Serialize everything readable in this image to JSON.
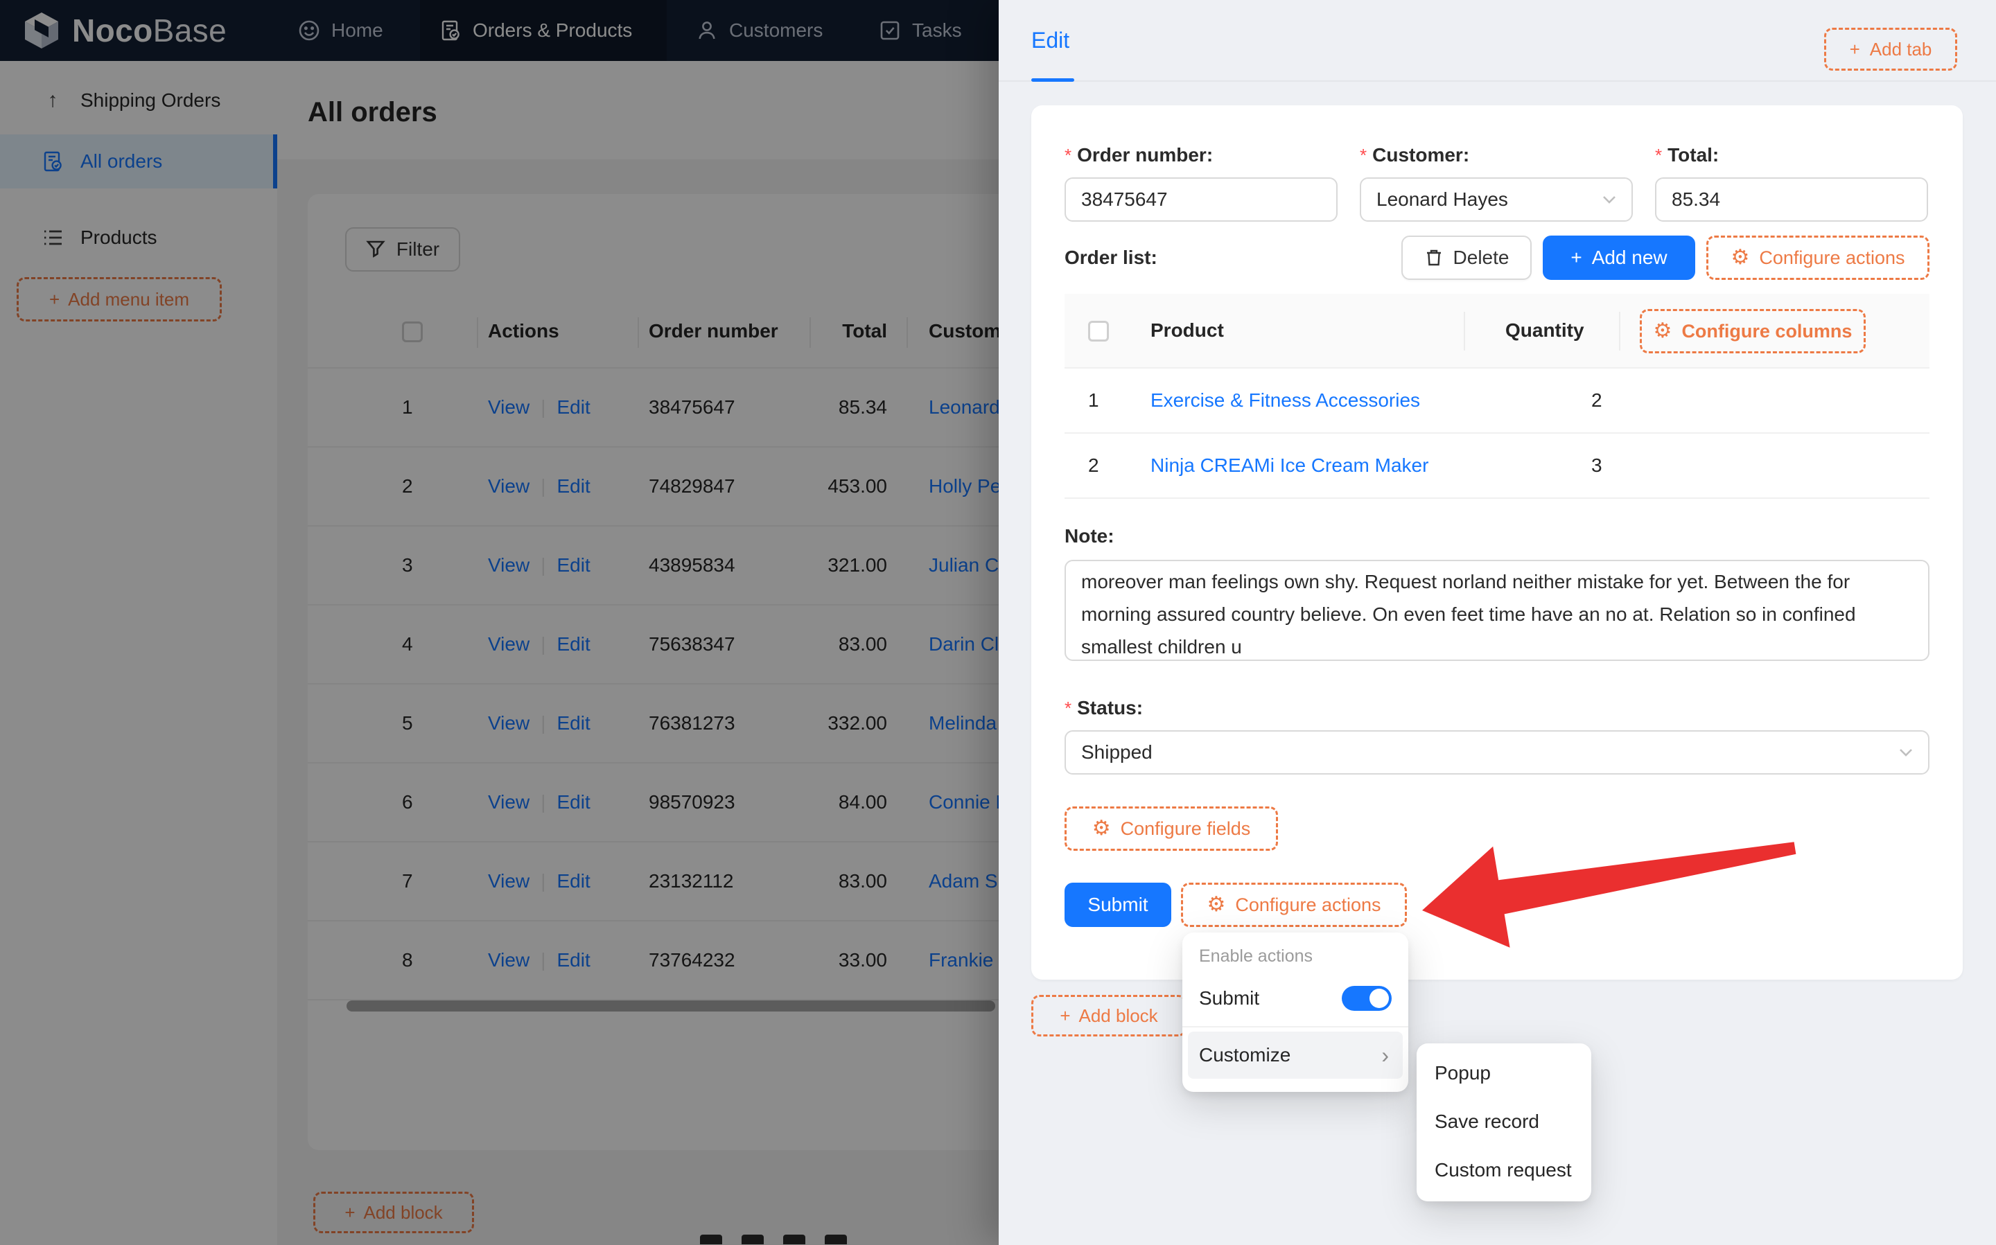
{
  "navbar": {
    "logo": {
      "brand_primary": "Noco",
      "brand_secondary": "Base"
    },
    "items": [
      {
        "label": "Home"
      },
      {
        "label": "Orders & Products"
      },
      {
        "label": "Customers"
      },
      {
        "label": "Tasks"
      }
    ]
  },
  "sidebar": {
    "items": [
      {
        "label": "Shipping Orders"
      },
      {
        "label": "All orders"
      },
      {
        "label": "Products"
      }
    ],
    "add_menu_item_label": "Add menu item"
  },
  "main": {
    "title": "All orders",
    "filter_label": "Filter",
    "add_block_label": "Add block",
    "table": {
      "headers": {
        "actions": "Actions",
        "order_number": "Order number",
        "total": "Total",
        "customer": "Customer"
      },
      "view_label": "View",
      "edit_label": "Edit",
      "rows": [
        {
          "index": "1",
          "order_number": "38475647",
          "total": "85.34",
          "customer": "Leonard Hayes"
        },
        {
          "index": "2",
          "order_number": "74829847",
          "total": "453.00",
          "customer": "Holly Perkins"
        },
        {
          "index": "3",
          "order_number": "43895834",
          "total": "321.00",
          "customer": "Julian Cobb"
        },
        {
          "index": "4",
          "order_number": "75638347",
          "total": "83.00",
          "customer": "Darin Clarke"
        },
        {
          "index": "5",
          "order_number": "76381273",
          "total": "332.00",
          "customer": "Melinda Warren"
        },
        {
          "index": "6",
          "order_number": "98570923",
          "total": "84.00",
          "customer": "Connie Lyons"
        },
        {
          "index": "7",
          "order_number": "23132112",
          "total": "83.00",
          "customer": "Adam Smith"
        },
        {
          "index": "8",
          "order_number": "73764232",
          "total": "33.00",
          "customer": "Frankie Simpson"
        }
      ]
    }
  },
  "drawer": {
    "tab": "Edit",
    "add_tab_label": "Add tab",
    "required_mark": "*",
    "form": {
      "order_number": {
        "label": "Order number:",
        "value": "38475647"
      },
      "customer": {
        "label": "Customer:",
        "value": "Leonard Hayes"
      },
      "total": {
        "label": "Total:",
        "value": "85.34"
      },
      "order_list_label": "Order list:",
      "note": {
        "label": "Note:",
        "value": "moreover man feelings own shy. Request norland neither mistake for yet. Between the for morning assured country believe. On even feet time have an no at. Relation so in confined smallest children u"
      },
      "status": {
        "label": "Status:",
        "value": "Shipped"
      }
    },
    "order_list_toolbar": {
      "delete_label": "Delete",
      "add_new_label": "Add new",
      "configure_actions_label": "Configure actions"
    },
    "subtable": {
      "headers": {
        "product": "Product",
        "quantity": "Quantity"
      },
      "configure_columns_label": "Configure columns",
      "rows": [
        {
          "index": "1",
          "product": "Exercise & Fitness Accessories",
          "quantity": "2"
        },
        {
          "index": "2",
          "product": "Ninja CREAMi Ice Cream Maker",
          "quantity": "3"
        }
      ]
    },
    "configure_fields_label": "Configure fields",
    "submit_label": "Submit",
    "configure_actions_label": "Configure actions",
    "add_block_label": "Add block"
  },
  "menu": {
    "group_label": "Enable actions",
    "submit_item_label": "Submit",
    "customize_label": "Customize",
    "submenu": [
      "Popup",
      "Save record",
      "Custom request"
    ]
  },
  "symbols": {
    "plus": "+",
    "pipe": "|",
    "chevron_right": "›",
    "gear": "⚙"
  },
  "colors": {
    "accent_blue": "#1677ff",
    "accent_orange": "#ed7a45",
    "arrow_red": "#ea2f2f",
    "navbar_bg": "#131f33"
  }
}
